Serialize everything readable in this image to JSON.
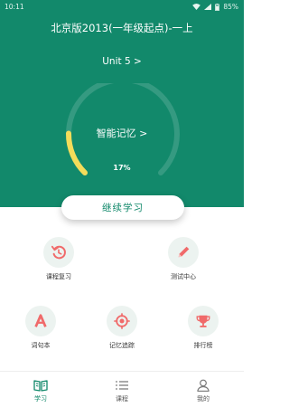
{
  "status_bar": {
    "time": "10:11",
    "battery": "85%"
  },
  "header": {
    "book_title": "北京版2013(一年级起点)-一上",
    "unit_link": "Unit 5 >"
  },
  "progress": {
    "memory_label": "智能记忆 >",
    "percent_text": "17%",
    "fraction": 0.17
  },
  "continue_button": "继续学习",
  "features": [
    {
      "label": "课程复习",
      "icon": "review-icon"
    },
    {
      "label": "测试中心",
      "icon": "pencil-icon"
    },
    {
      "label": "词句本",
      "icon": "letter-a-icon"
    },
    {
      "label": "记忆追踪",
      "icon": "target-icon"
    },
    {
      "label": "排行榜",
      "icon": "trophy-icon"
    }
  ],
  "tabs": [
    {
      "label": "学习",
      "icon": "book-icon",
      "active": true
    },
    {
      "label": "课程",
      "icon": "list-icon",
      "active": false
    },
    {
      "label": "我的",
      "icon": "user-icon",
      "active": false
    }
  ],
  "colors": {
    "primary": "#12896b",
    "accent_icon": "#f06a6a",
    "progress": "#f3dc5a",
    "icon_bg": "#ecf3f0"
  }
}
